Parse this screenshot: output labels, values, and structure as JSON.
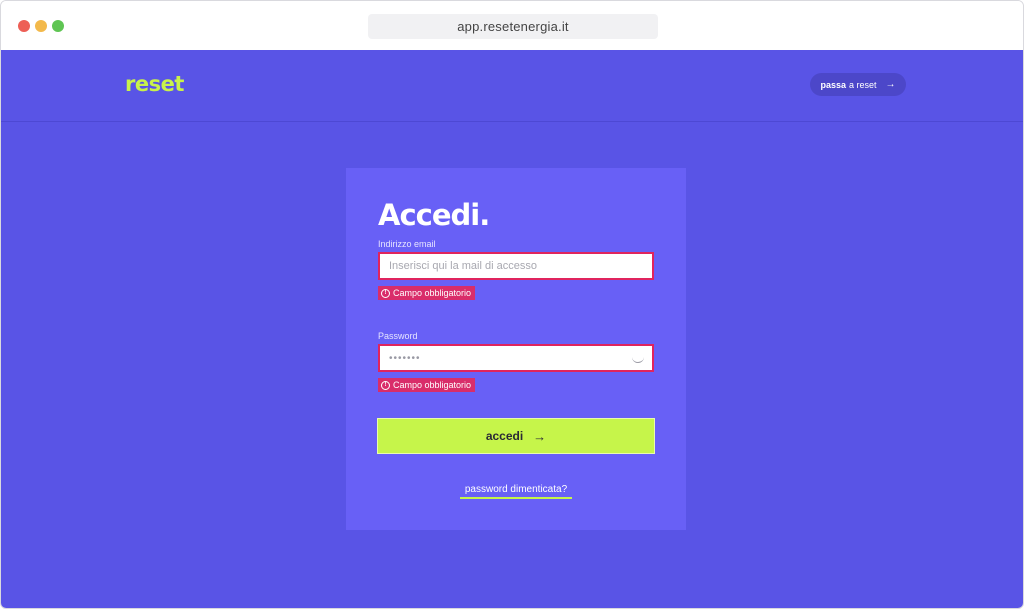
{
  "browser": {
    "url": "app.resetenergia.it"
  },
  "header": {
    "logo": "reset",
    "switch_bold": "passa",
    "switch_rest": "a reset",
    "switch_arrow": "→"
  },
  "login": {
    "title": "Accedi.",
    "email": {
      "label": "Indirizzo email",
      "placeholder": "Inserisci qui la mail di accesso",
      "error": "Campo obbligatorio"
    },
    "password": {
      "label": "Password",
      "value": "•••••••",
      "error": "Campo obbligatorio"
    },
    "error_icon": "!",
    "submit_label": "accedi",
    "submit_arrow": "→",
    "forgot_link": "password dimenticata?"
  },
  "colors": {
    "background": "#5954e6",
    "card": "#6860f6",
    "accent": "#c6f54a",
    "error": "#e0245e"
  }
}
